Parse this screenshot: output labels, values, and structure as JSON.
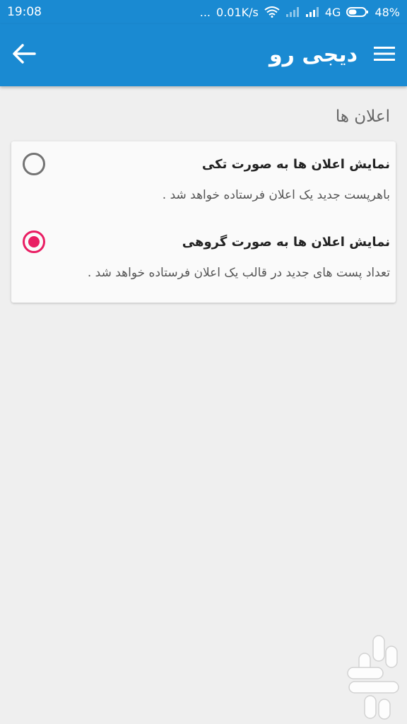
{
  "status_bar": {
    "time": "19:08",
    "dots": "...",
    "network_speed": "0.01K/s",
    "network_type": "4G",
    "battery": "48%"
  },
  "app_bar": {
    "title": "دیجی رو",
    "back_icon": "arrow-left-icon",
    "menu_icon": "hamburger-menu-icon"
  },
  "section": {
    "title": "اعلان ها"
  },
  "options": [
    {
      "title": "نمایش اعلان ها به صورت تکی",
      "description": "باهرپست جدید یک اعلان فرستاده خواهد شد .",
      "selected": false
    },
    {
      "title": "نمایش اعلان ها به صورت گروهی",
      "description": "تعداد پست های جدید در قالب یک اعلان فرستاده خواهد شد .",
      "selected": true
    }
  ],
  "colors": {
    "primary": "#1a8ad2",
    "accent": "#e91e63",
    "background": "#efefef",
    "card": "#fafafa"
  }
}
